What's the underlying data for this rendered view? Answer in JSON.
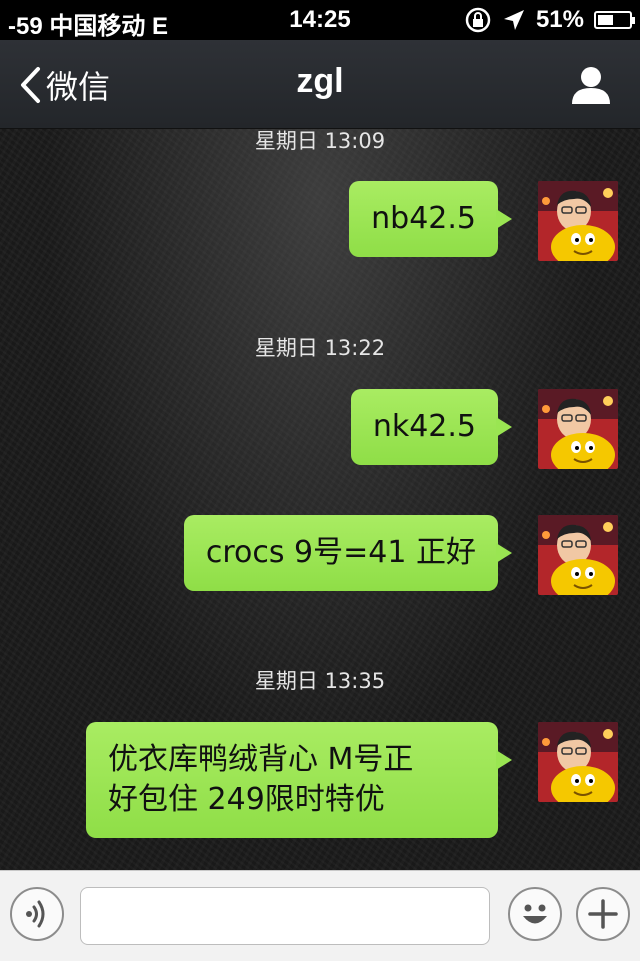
{
  "status_bar": {
    "carrier": "-59 中国移动 E",
    "time": "14:25",
    "battery_percent_label": "51%",
    "battery_level": 0.51
  },
  "nav": {
    "back_label": "微信",
    "title": "zgl"
  },
  "chat": {
    "timestamps": [
      "星期日 13:09",
      "星期日 13:22",
      "星期日 13:35"
    ],
    "messages": [
      {
        "text": "nb42.5"
      },
      {
        "text": "nk42.5"
      },
      {
        "text": "crocs 9号=41 正好"
      },
      {
        "text": "优衣库鸭绒背心 M号正\n好包住 249限时特优"
      }
    ]
  },
  "input_bar": {
    "placeholder": ""
  },
  "colors": {
    "bubble": "#9ae552",
    "navbar": "#2a2d31",
    "statusbar": "#000000",
    "inputbar": "#f2f2f2"
  },
  "icons": {
    "back": "chevron-left-icon",
    "profile": "person-icon",
    "voice": "voice-wave-icon",
    "emoji": "smiley-icon",
    "add": "plus-icon",
    "orientation_lock": "rotation-lock-icon",
    "location": "location-arrow-icon",
    "battery": "battery-icon"
  }
}
